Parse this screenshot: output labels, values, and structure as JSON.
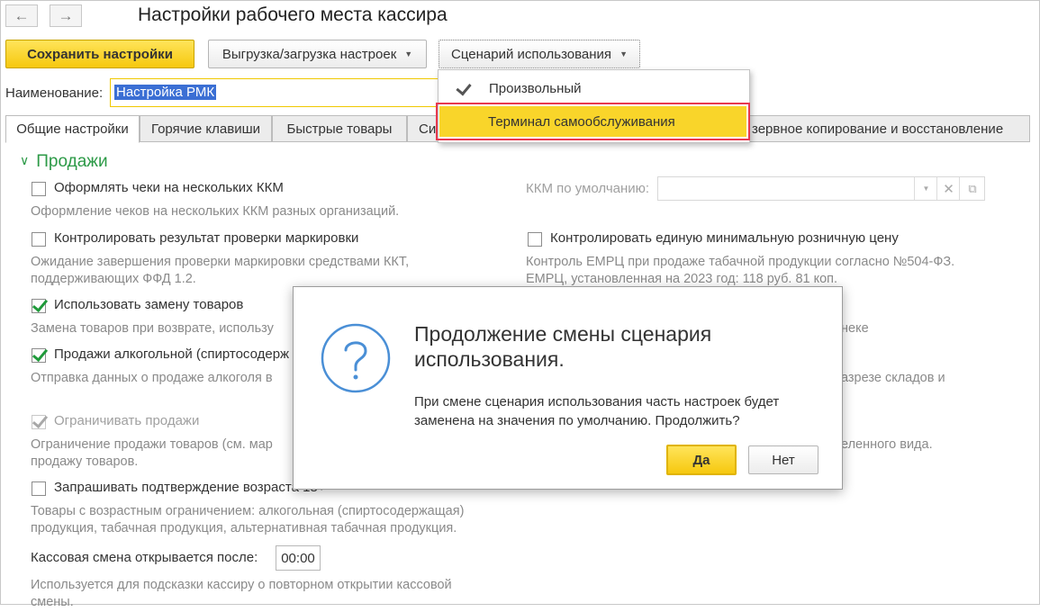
{
  "window": {
    "title": "Настройки рабочего места кассира",
    "nav": {
      "back_glyph": "←",
      "forward_glyph": "→"
    }
  },
  "toolbar": {
    "save_label": "Сохранить настройки",
    "export_label": "Выгрузка/загрузка настроек",
    "scenario_label": "Сценарий использования"
  },
  "name_field": {
    "label": "Наименование:",
    "value": "Настройка РМК"
  },
  "tabs": [
    {
      "label": "Общие настройки",
      "active": true
    },
    {
      "label": "Горячие клавиши"
    },
    {
      "label": "Быстрые товары"
    },
    {
      "label": "Си"
    },
    {
      "label": "зервное копирование и восстановление"
    }
  ],
  "section": {
    "title": "Продажи"
  },
  "options": {
    "multi_kkm": {
      "label": "Оформлять чеки на нескольких ККМ",
      "checked": false,
      "hint": "Оформление чеков на нескольких ККМ разных организаций."
    },
    "kkm_default": {
      "label": "ККМ по умолчанию:"
    },
    "marking_check": {
      "label": "Контролировать результат проверки маркировки",
      "checked": false,
      "hint1": "Ожидание завершения проверки маркировки средствами ККТ,",
      "hint2": "поддерживающих ФФД 1.2."
    },
    "emrc": {
      "label": "Контролировать единую минимальную розничную цену",
      "checked": false,
      "hint1": "Контроль ЕМРЦ при продаже табачной продукции согласно №504-ФЗ.",
      "hint2": "ЕМРЦ, установленная на 2023 год: 118 руб. 81 коп."
    },
    "replace": {
      "label": "Использовать замену товаров",
      "checked": true,
      "hint": "Замена товаров при возврате, использу"
    },
    "alcohol": {
      "label": "Продажи алкогольной (спиртосодерж",
      "checked": true,
      "hint": "Отправка данных о продаже алкоголя в"
    },
    "right_frag1": "неке",
    "right_frag2": "азрезе складов и",
    "right_frag3": "еленного вида.",
    "restrict": {
      "label": "Ограничивать продажи",
      "checked": true,
      "disabled": true,
      "hint1": "Ограничение продажи товаров (см. мар",
      "hint2": "продажу товаров."
    },
    "age": {
      "label": "Запрашивать подтверждение возраста 18+",
      "checked": false,
      "hint1": "Товары с возрастным ограничением: алкогольная (спиртосодержащая)",
      "hint2": "продукция, табачная продукция, альтернативная табачная продукция."
    },
    "shift": {
      "label": "Кассовая смена открывается после:",
      "value": "00:00",
      "hint1": "Используется для подсказки кассиру о повторном открытии кассовой",
      "hint2": "смены."
    }
  },
  "scenario_menu": {
    "items": [
      {
        "label": "Произвольный",
        "checked": true
      },
      {
        "label": "Терминал самообслуживания",
        "highlighted": true
      }
    ]
  },
  "dialog": {
    "title": "Продолжение смены сценария использования.",
    "text": "При смене сценария использования часть настроек будет заменена на значения по умолчанию. Продолжить?",
    "yes_label": "Да",
    "no_label": "Нет"
  },
  "colors": {
    "accent_yellow": "#f6c80e",
    "section_green": "#2c9a47",
    "check_green": "#1f9a3a",
    "highlight_red": "#e8384f"
  }
}
